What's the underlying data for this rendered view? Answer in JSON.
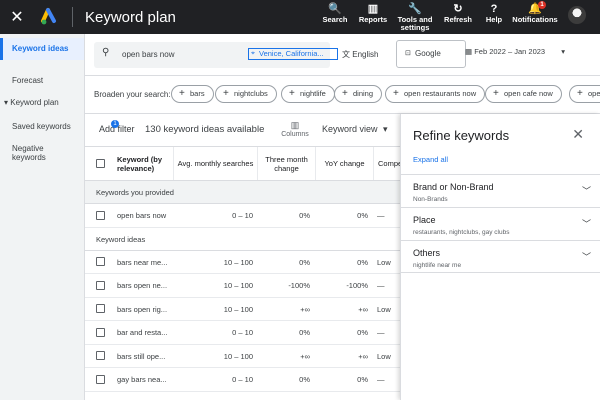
{
  "app": {
    "title": "Keyword plan",
    "close_glyph": "✕",
    "logo_icon": "google-ads-logo"
  },
  "top_actions": [
    {
      "label": "Search",
      "icon": "🔍"
    },
    {
      "label": "Reports",
      "icon": "▥"
    },
    {
      "label": "Tools and settings",
      "icon": "🔧"
    },
    {
      "label": "Refresh",
      "icon": "↻"
    },
    {
      "label": "Help",
      "icon": "?"
    },
    {
      "label": "Notifications",
      "icon": "🔔",
      "badge": "1"
    }
  ],
  "sidebar": {
    "items": [
      {
        "label": "Keyword ideas",
        "active": true
      },
      {
        "label": "Forecast"
      },
      {
        "label": "▾ Keyword plan"
      },
      {
        "label": "Saved keywords"
      },
      {
        "label": "Negative keywords"
      }
    ]
  },
  "search": {
    "query": "open bars now",
    "location": "Venice, California...",
    "language": "English",
    "network": "Google",
    "date_range": "Feb 2022 – Jan 2023"
  },
  "broaden": {
    "label": "Broaden your search:",
    "chips": [
      "bars",
      "nightclubs",
      "nightlife",
      "dining",
      "open restaurants now",
      "open cafe now",
      "oper"
    ]
  },
  "toolbar": {
    "add_filter": "Add filter",
    "filter_badge": "1",
    "ideas_count": "130 keyword ideas available",
    "columns": "Columns",
    "keyword_view": "Keyword view"
  },
  "table": {
    "headers": {
      "keyword": "Keyword (by relevance)",
      "avg": "Avg. monthly searches",
      "three_month": "Three month change",
      "yoy": "YoY change",
      "comp": "Compe"
    },
    "provided_label": "Keywords you provided",
    "provided_rows": [
      {
        "kw": "open bars now",
        "avg": "0 – 10",
        "three": "0%",
        "yoy": "0%",
        "comp": "—"
      }
    ],
    "ideas_label": "Keyword ideas",
    "idea_rows": [
      {
        "kw": "bars near me...",
        "avg": "10 – 100",
        "three": "0%",
        "yoy": "0%",
        "comp": "Low"
      },
      {
        "kw": "bars open ne...",
        "avg": "10 – 100",
        "three": "-100%",
        "yoy": "-100%",
        "comp": "—"
      },
      {
        "kw": "bars open rig...",
        "avg": "10 – 100",
        "three": "+∞",
        "yoy": "+∞",
        "comp": "Low"
      },
      {
        "kw": "bar and resta...",
        "avg": "0 – 10",
        "three": "0%",
        "yoy": "0%",
        "comp": "—"
      },
      {
        "kw": "bars still ope...",
        "avg": "10 – 100",
        "three": "+∞",
        "yoy": "+∞",
        "comp": "Low"
      },
      {
        "kw": "gay bars nea...",
        "avg": "0 – 10",
        "three": "0%",
        "yoy": "0%",
        "comp": "—"
      }
    ]
  },
  "refine": {
    "title": "Refine keywords",
    "expand_all": "Expand all",
    "groups": [
      {
        "title": "Brand or Non-Brand",
        "sub": "Non-Brands"
      },
      {
        "title": "Place",
        "sub": "restaurants, nightclubs, gay clubs"
      },
      {
        "title": "Others",
        "sub": "nightlife near me"
      }
    ]
  },
  "colors": {
    "topbar": "#202124",
    "accent": "#1a73e8",
    "badge": "#d93025"
  }
}
